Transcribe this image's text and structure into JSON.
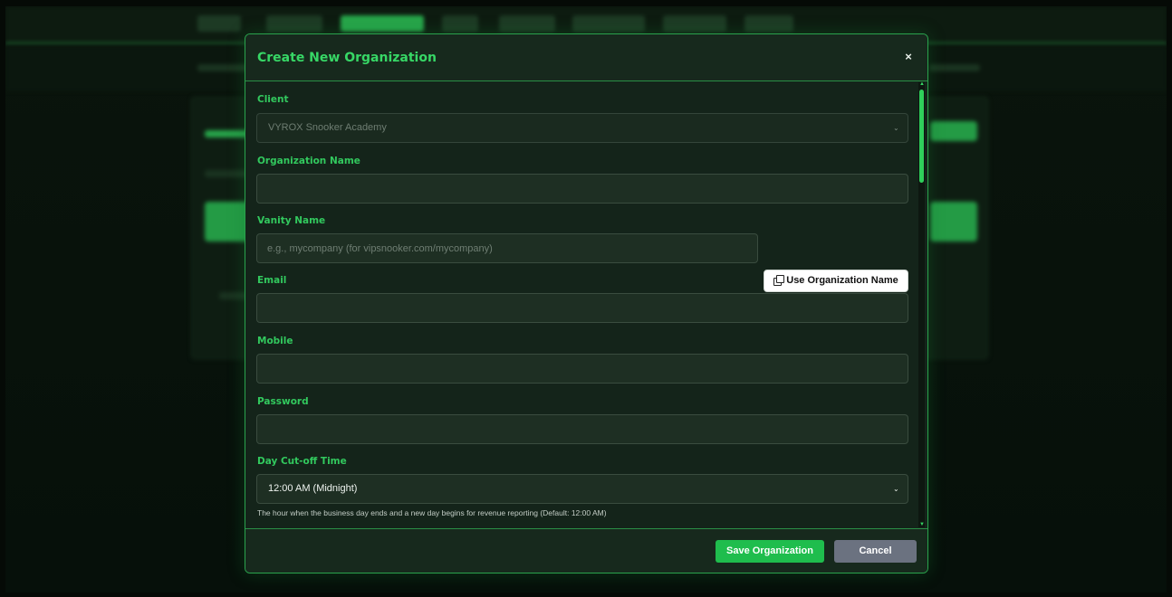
{
  "modal": {
    "title": "Create New Organization",
    "close_label": "×"
  },
  "fields": {
    "client": {
      "label": "Client",
      "value": "VYROX Snooker Academy"
    },
    "organization_name": {
      "label": "Organization Name",
      "value": ""
    },
    "vanity_name": {
      "label": "Vanity Name",
      "placeholder": "e.g., mycompany (for vipsnooker.com/mycompany)",
      "use_org_button": "Use Organization Name"
    },
    "email": {
      "label": "Email",
      "value": ""
    },
    "mobile": {
      "label": "Mobile",
      "value": ""
    },
    "password": {
      "label": "Password",
      "value": ""
    },
    "day_cutoff": {
      "label": "Day Cut-off Time",
      "value": "12:00 AM (Midnight)",
      "help": "The hour when the business day ends and a new day begins for revenue reporting (Default: 12:00 AM)"
    }
  },
  "footer": {
    "save_label": "Save Organization",
    "cancel_label": "Cancel"
  },
  "colors": {
    "accent": "#37d766",
    "save": "#1fbd4d",
    "cancel": "#6b7280"
  }
}
